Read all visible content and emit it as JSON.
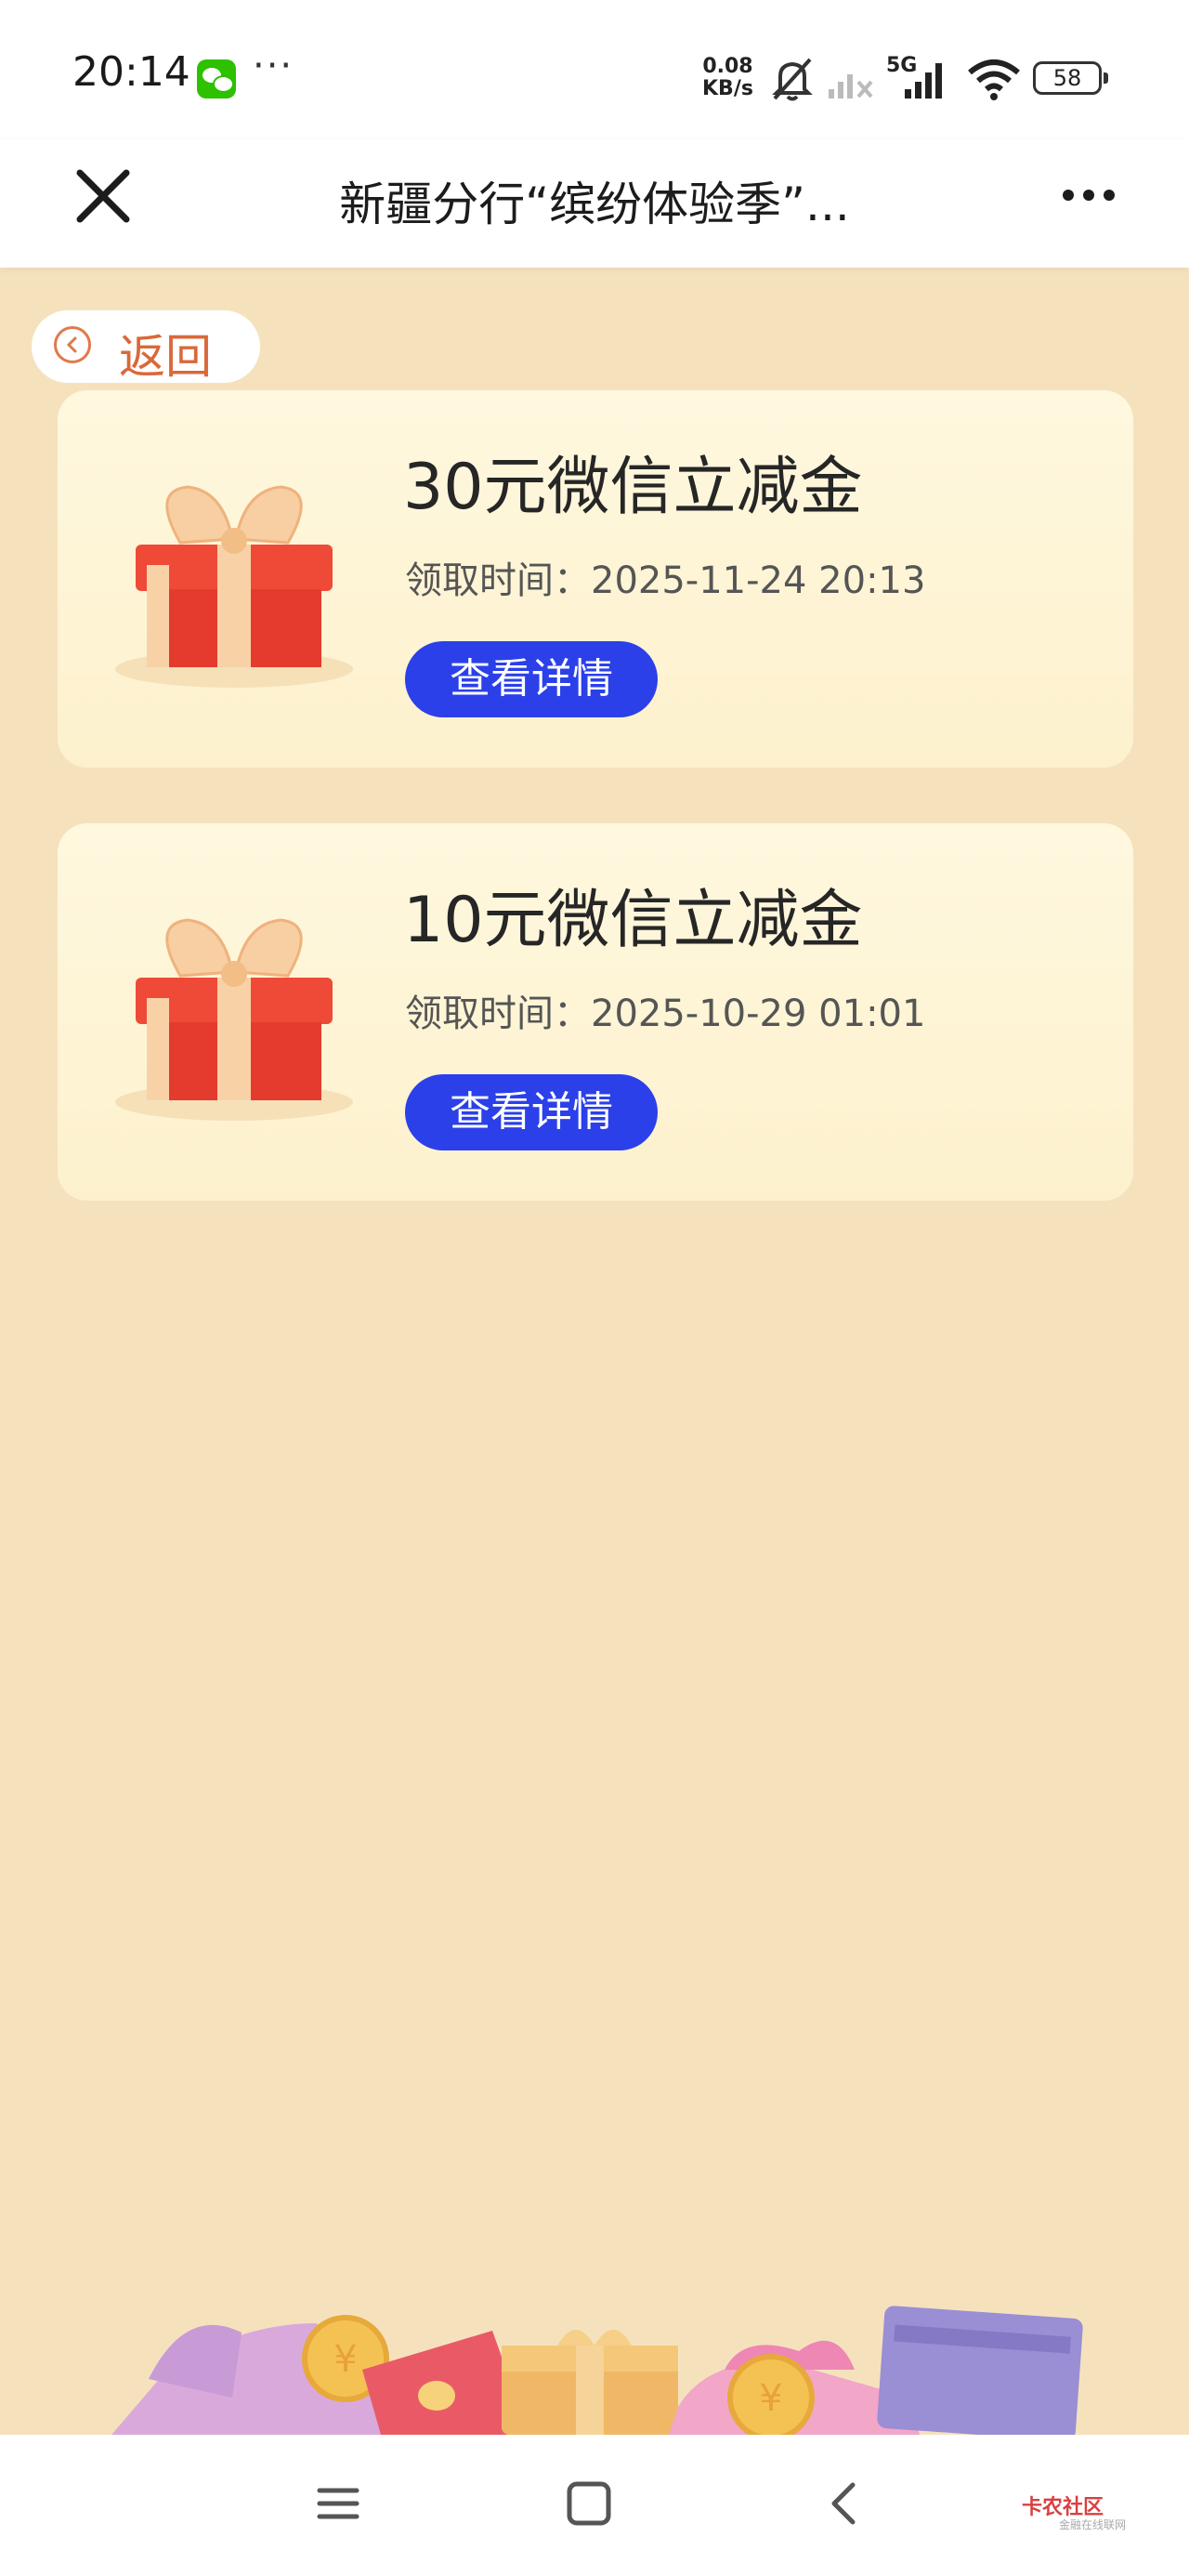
{
  "status_bar": {
    "time": "20:14",
    "dots": "···",
    "net_speed_value": "0.08",
    "net_speed_unit": "KB/s",
    "network": "5G",
    "battery": "58",
    "icons": [
      "wechat-icon",
      "mute-bell-icon",
      "signal-off-icon",
      "signal-icon",
      "wifi-icon",
      "battery-icon"
    ]
  },
  "nav": {
    "title": "新疆分行“缤纷体验季”...",
    "icons": [
      "close-icon",
      "more-icon"
    ]
  },
  "back_label": "返回",
  "cards": [
    {
      "title": "30元微信立减金",
      "time": "领取时间：2025-11-24 20:13",
      "button": "查看详情"
    },
    {
      "title": "10元微信立减金",
      "time": "领取时间：2025-10-29 01:01",
      "button": "查看详情"
    }
  ],
  "bottom_nav": {
    "icons": [
      "menu-icon",
      "home-icon",
      "back-icon"
    ],
    "watermark": "卡农社区",
    "watermark_sub": "金融在线联网"
  },
  "colors": {
    "page_bg": "#f5e2bd",
    "card_bg": "#fff8df",
    "button_bg": "#2b40e9",
    "back_accent": "#d9683a",
    "gift_red": "#e84334",
    "ribbon": "#f7cfa3"
  }
}
